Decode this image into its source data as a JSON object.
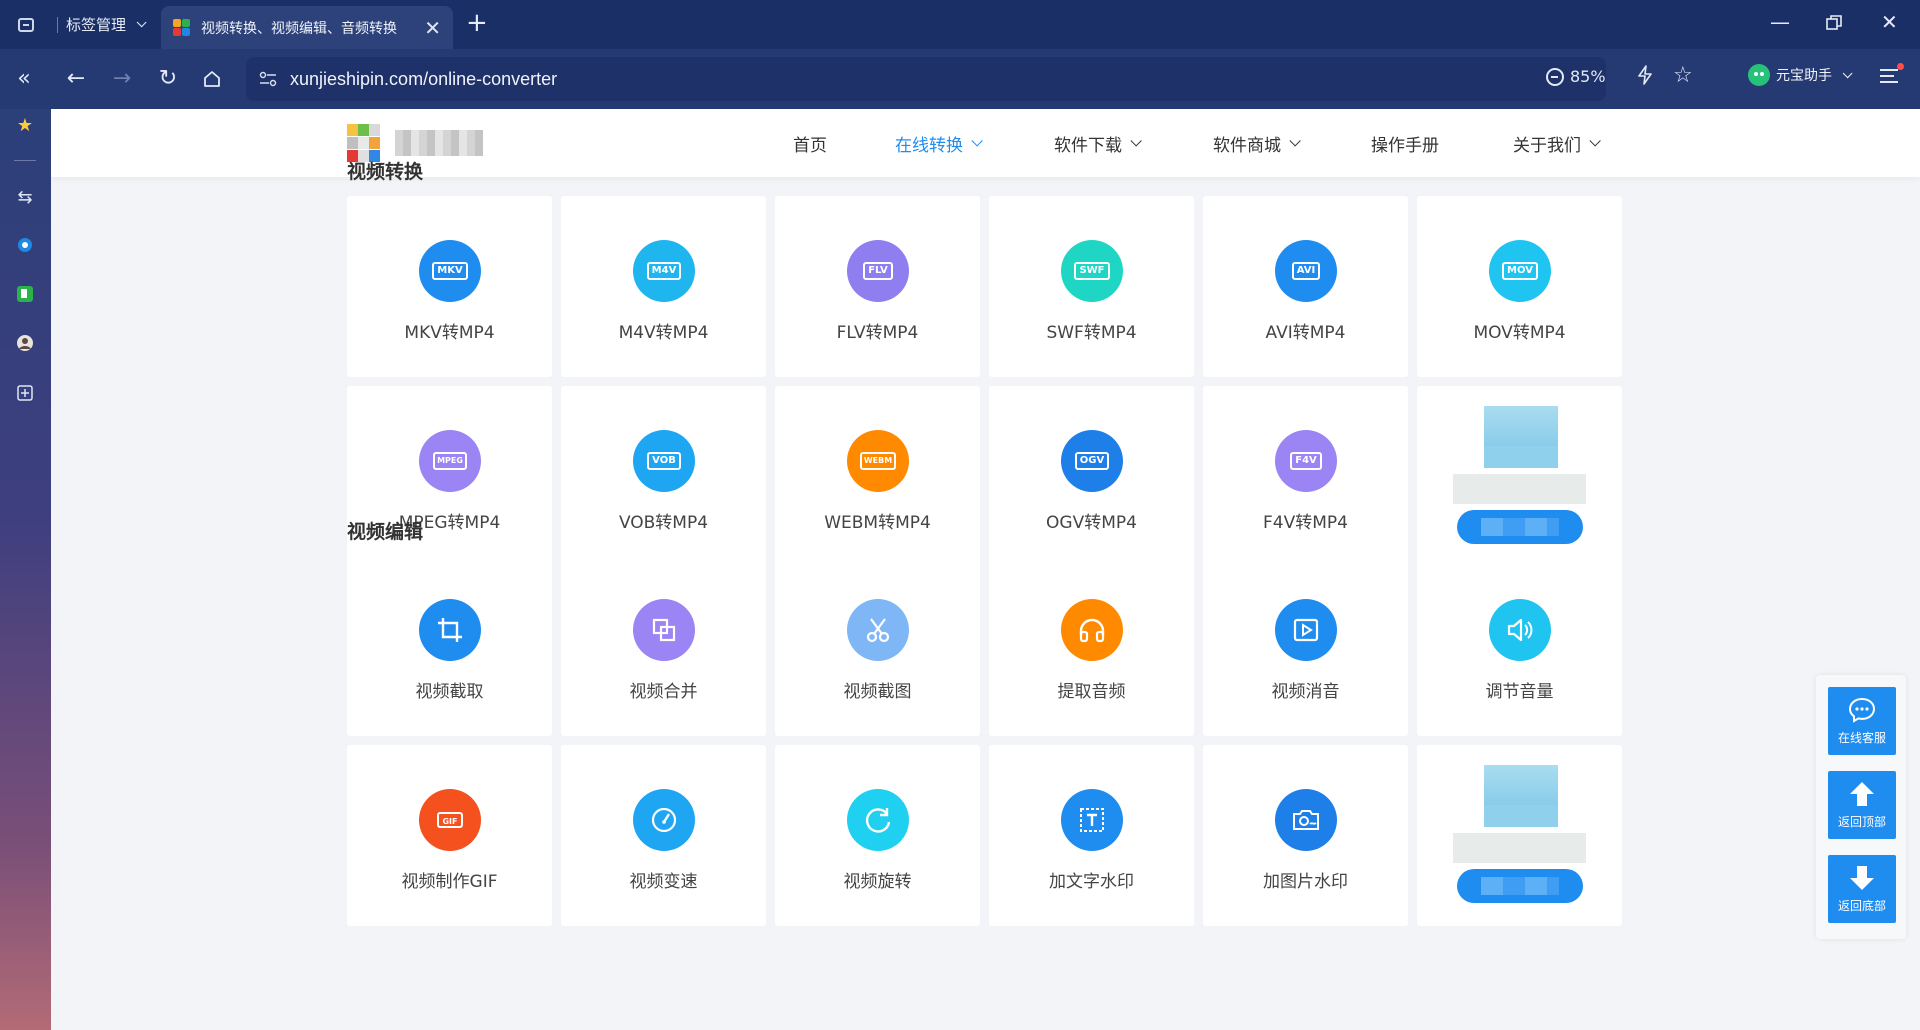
{
  "browser": {
    "tab_group_label": "标签管理",
    "active_tab_title": "视频转换、视频编辑、音频转换",
    "url": "xunjieshipin.com/online-converter",
    "zoom": "85%",
    "assistant_label": "元宝助手"
  },
  "site": {
    "nav": [
      {
        "label": "首页",
        "active": false,
        "dropdown": false
      },
      {
        "label": "在线转换",
        "active": true,
        "dropdown": true
      },
      {
        "label": "软件下载",
        "active": false,
        "dropdown": true
      },
      {
        "label": "软件商城",
        "active": false,
        "dropdown": true
      },
      {
        "label": "操作手册",
        "active": false,
        "dropdown": false
      },
      {
        "label": "关于我们",
        "active": false,
        "dropdown": true
      }
    ],
    "accent": "#1f8cf0"
  },
  "video_convert": {
    "title": "视频转换",
    "items": [
      {
        "label": "MKV转MP4",
        "badge": "MKV",
        "color": "#1f8cf0"
      },
      {
        "label": "M4V转MP4",
        "badge": "M4V",
        "color": "#1fb6f0"
      },
      {
        "label": "FLV转MP4",
        "badge": "FLV",
        "color": "#8f7ef0"
      },
      {
        "label": "SWF转MP4",
        "badge": "SWF",
        "color": "#1fd6c4"
      },
      {
        "label": "AVI转MP4",
        "badge": "AVI",
        "color": "#1f8cf0"
      },
      {
        "label": "MOV转MP4",
        "badge": "MOV",
        "color": "#1fc4f0"
      },
      {
        "label": "MPEG转MP4",
        "badge": "MPEG",
        "color": "#9b84f3"
      },
      {
        "label": "VOB转MP4",
        "badge": "VOB",
        "color": "#1fa6f3"
      },
      {
        "label": "WEBM转MP4",
        "badge": "WEBM",
        "color": "#ff8a00"
      },
      {
        "label": "OGV转MP4",
        "badge": "OGV",
        "color": "#1f7fe8"
      },
      {
        "label": "F4V转MP4",
        "badge": "F4V",
        "color": "#9b84f3"
      }
    ]
  },
  "video_edit": {
    "title": "视频编辑",
    "items": [
      {
        "label": "视频截取",
        "icon": "crop-icon",
        "color": "#1f8cf0"
      },
      {
        "label": "视频合并",
        "icon": "merge-icon",
        "color": "#9b84f3"
      },
      {
        "label": "视频截图",
        "icon": "scissors-icon",
        "color": "#7fb6f5"
      },
      {
        "label": "提取音频",
        "icon": "headphones-icon",
        "color": "#ff8a00"
      },
      {
        "label": "视频消音",
        "icon": "play-icon",
        "color": "#1f8cf0"
      },
      {
        "label": "调节音量",
        "icon": "volume-icon",
        "color": "#1fc4f0"
      },
      {
        "label": "视频制作GIF",
        "icon": "gif-icon",
        "color": "#f4511e"
      },
      {
        "label": "视频变速",
        "icon": "speedometer-icon",
        "color": "#1fa6f3"
      },
      {
        "label": "视频旋转",
        "icon": "rotate-icon",
        "color": "#1fd0f0"
      },
      {
        "label": "加文字水印",
        "icon": "text-watermark-icon",
        "color": "#1f8cf0"
      },
      {
        "label": "加图片水印",
        "icon": "image-watermark-icon",
        "color": "#1f7fe8"
      }
    ]
  },
  "float_panel": {
    "chat_label": "在线客服",
    "top_label": "返回顶部",
    "bottom_label": "返回底部"
  }
}
